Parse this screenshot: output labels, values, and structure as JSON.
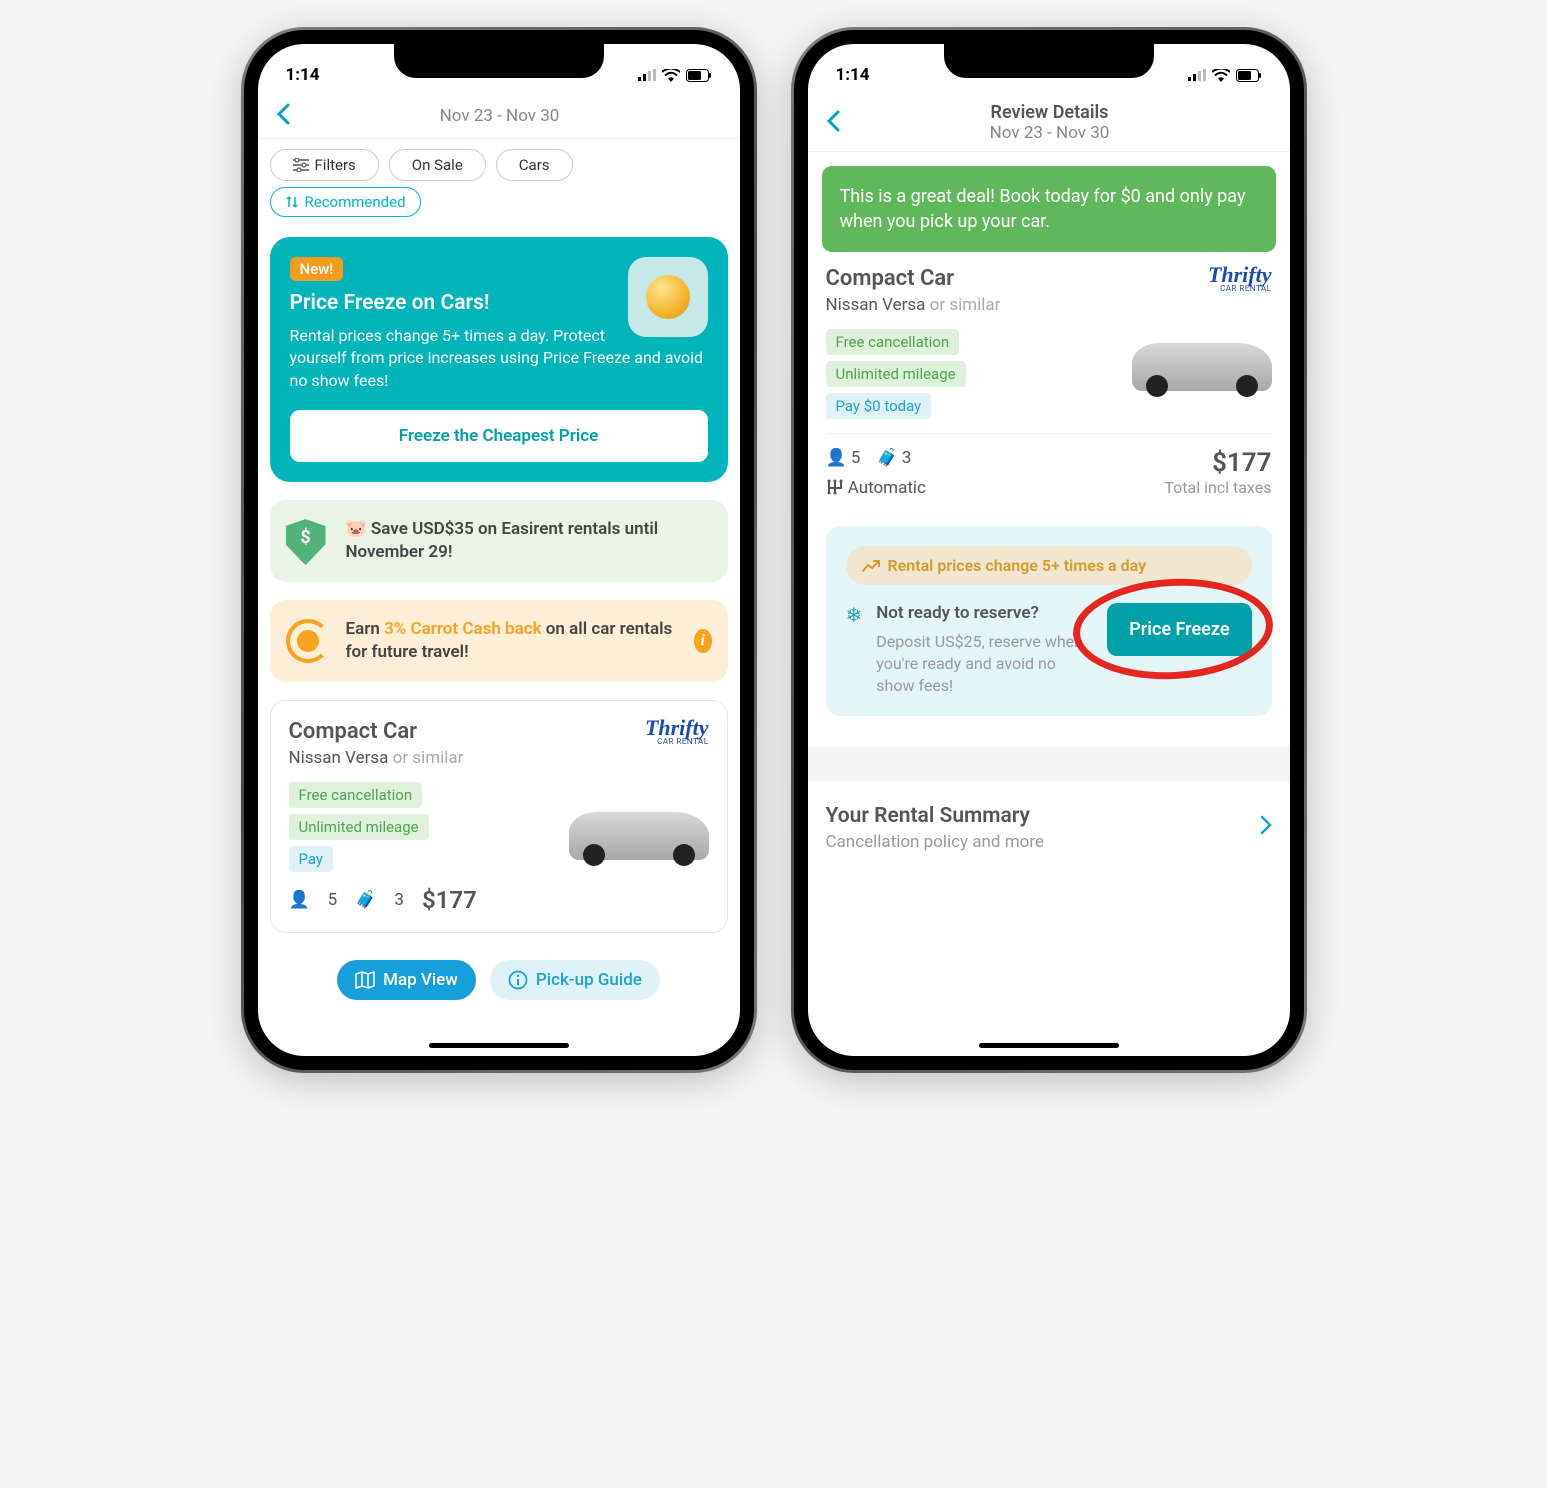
{
  "status": {
    "time": "1:14"
  },
  "left": {
    "nav_sub": "Nov 23 - Nov 30",
    "filters": {
      "filters": "Filters",
      "onsale": "On Sale",
      "cars": "Cars",
      "recommended": "Recommended"
    },
    "pf": {
      "badge": "New!",
      "title": "Price Freeze on Cars!",
      "body": "Rental prices change 5+ times a day. Protect yourself from price increases using Price Freeze and avoid no show fees!",
      "cta": "Freeze the Cheapest Price"
    },
    "promo1_emoji": "🐷",
    "promo1": "Save USD$35 on Easirent rentals until November 29!",
    "promo2_pre": "Earn ",
    "promo2_hl": "3% Carrot Cash back",
    "promo2_post": " on all car rentals for future travel!",
    "car": {
      "title": "Compact Car",
      "model": "Nissan Versa",
      "sim": "or similar",
      "brand": "Thrifty",
      "brand_sub": "CAR RENTAL",
      "tag1": "Free cancellation",
      "tag2": "Unlimited mileage",
      "tag3": "Pay",
      "pax": "5",
      "bags": "3",
      "price": "$177"
    },
    "fab_map": "Map View",
    "fab_guide": "Pick-up Guide"
  },
  "right": {
    "nav_title": "Review Details",
    "nav_sub": "Nov 23 - Nov 30",
    "banner": "This is a great deal! Book today for $0 and only pay when you pick up your car.",
    "car": {
      "title": "Compact Car",
      "model": "Nissan Versa",
      "sim": "or similar",
      "brand": "Thrifty",
      "brand_sub": "CAR RENTAL",
      "tag1": "Free cancellation",
      "tag2": "Unlimited mileage",
      "tag3": "Pay $0 today",
      "pax": "5",
      "bags": "3",
      "trans": "Automatic",
      "price": "$177",
      "price_sub": "Total incl taxes"
    },
    "freeze": {
      "pill": "Rental prices change 5+ times a day",
      "q": "Not ready to reserve?",
      "d": "Deposit US$25, reserve when you're ready and avoid no show fees!",
      "btn": "Price Freeze"
    },
    "summary": {
      "title": "Your Rental Summary",
      "sub": "Cancellation policy and more"
    }
  }
}
